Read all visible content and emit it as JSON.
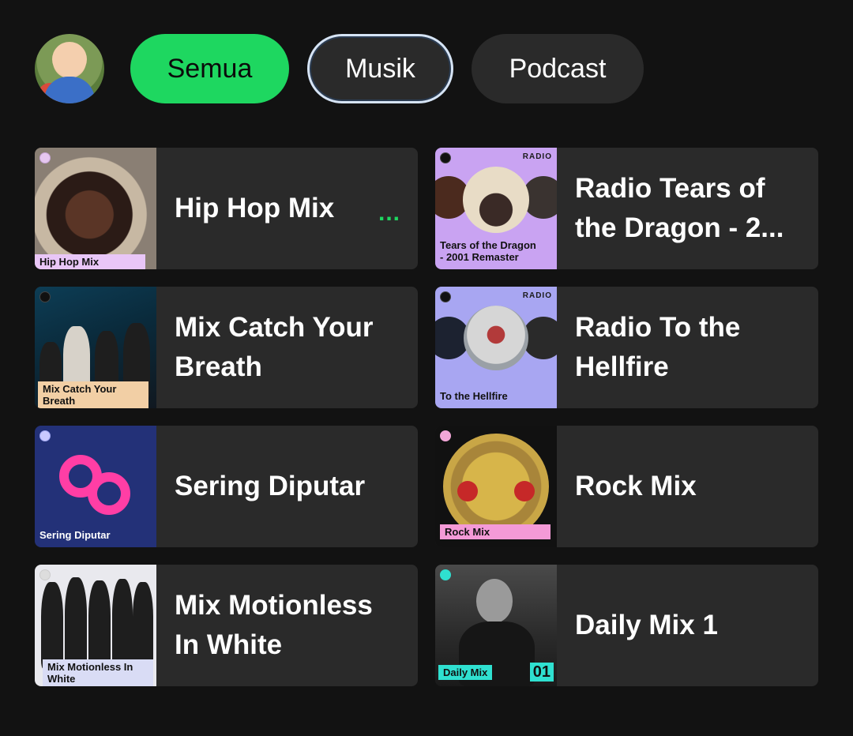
{
  "filters": {
    "semua": "Semua",
    "musik": "Musik",
    "podcast": "Podcast"
  },
  "cards": [
    {
      "title": "Hip Hop Mix",
      "cover_label": "Hip Hop Mix",
      "more": "..."
    },
    {
      "title": "Radio Tears of the Dragon - 2...",
      "cover_label": "Tears of the Dragon - 2001 Remaster",
      "cover_tag": "RADIO"
    },
    {
      "title": "Mix Catch Your Breath",
      "cover_label": "Mix Catch Your Breath"
    },
    {
      "title": "Radio To the Hellfire",
      "cover_label": "To the Hellfire",
      "cover_tag": "RADIO"
    },
    {
      "title": "Sering Diputar",
      "cover_label": "Sering Diputar"
    },
    {
      "title": "Rock Mix",
      "cover_label": "Rock Mix"
    },
    {
      "title": "Mix Motionless In White",
      "cover_label": "Mix Motionless In White"
    },
    {
      "title": "Daily Mix 1",
      "cover_label": "Daily Mix",
      "cover_number": "01"
    }
  ],
  "colors": {
    "accent": "#1ed760",
    "background": "#121212",
    "card": "#2a2a2a"
  }
}
